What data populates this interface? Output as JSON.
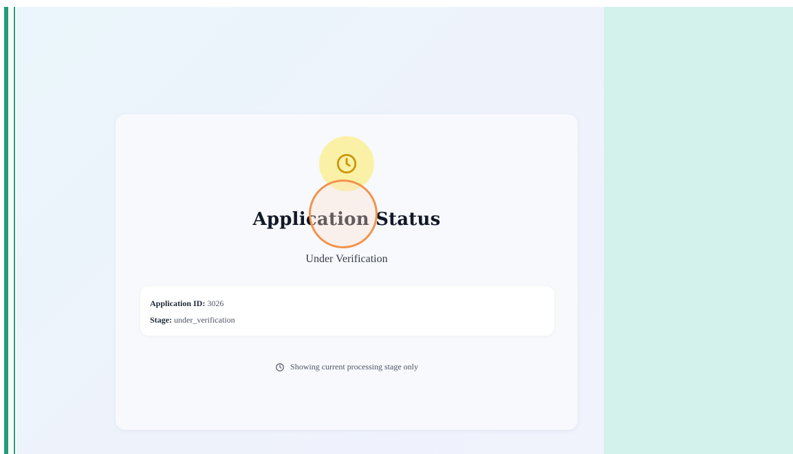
{
  "status_card": {
    "icon": "clock-icon",
    "title": "Application Status",
    "subtitle": "Under Verification",
    "details": {
      "application_id_label": "Application ID:",
      "application_id_value": "3026",
      "stage_label": "Stage:",
      "stage_value": "under_verification"
    },
    "note_icon": "clock-icon",
    "note": "Showing current processing stage only"
  },
  "colors": {
    "accent_green": "#1f9e78",
    "right_panel": "#d4f2ec",
    "icon_bg": "#fbf1a6",
    "icon_stroke": "#c9960a",
    "click_ring": "#f0934a"
  }
}
